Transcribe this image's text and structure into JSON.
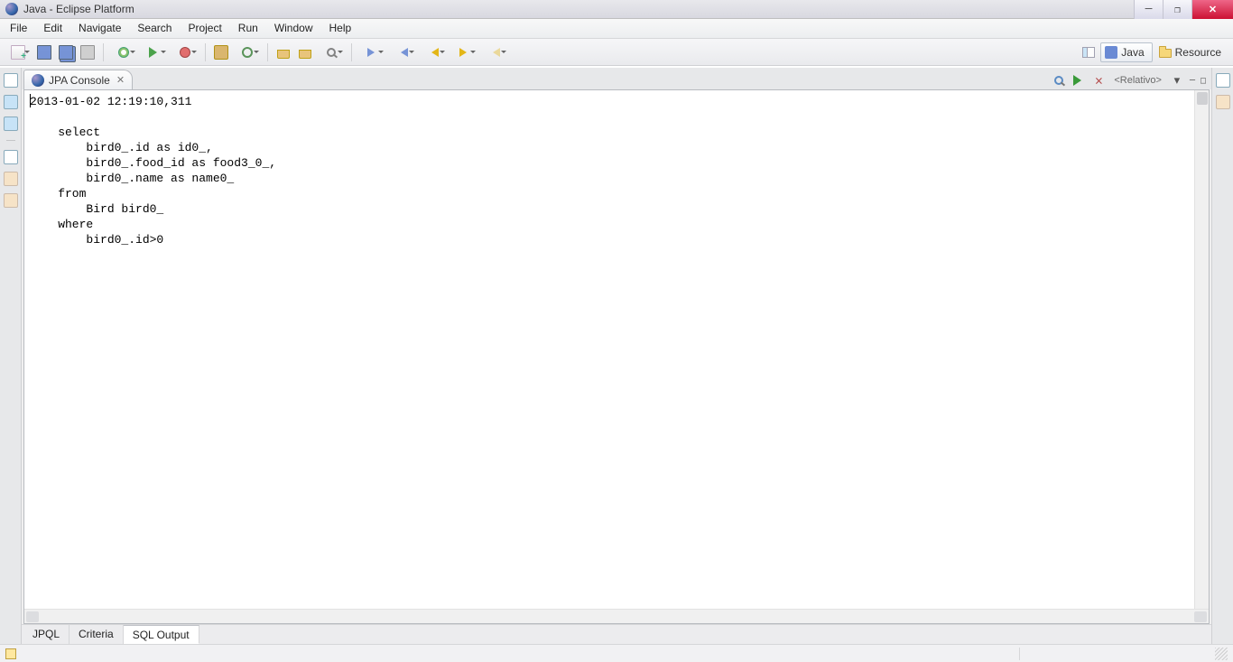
{
  "window": {
    "title": "Java - Eclipse Platform"
  },
  "menubar": [
    "File",
    "Edit",
    "Navigate",
    "Search",
    "Project",
    "Run",
    "Window",
    "Help"
  ],
  "perspectives": {
    "active": "Java",
    "other": "Resource"
  },
  "view": {
    "tab_title": "JPA Console",
    "relative_label": "<Relativo>"
  },
  "console": {
    "timestamp": "2013-01-02 12:19:10,311",
    "sql": "    select\n        bird0_.id as id0_,\n        bird0_.food_id as food3_0_,\n        bird0_.name as name0_ \n    from\n        Bird bird0_ \n    where\n        bird0_.id>0"
  },
  "bottom_tabs": [
    "JPQL",
    "Criteria",
    "SQL Output"
  ],
  "bottom_active_index": 2
}
